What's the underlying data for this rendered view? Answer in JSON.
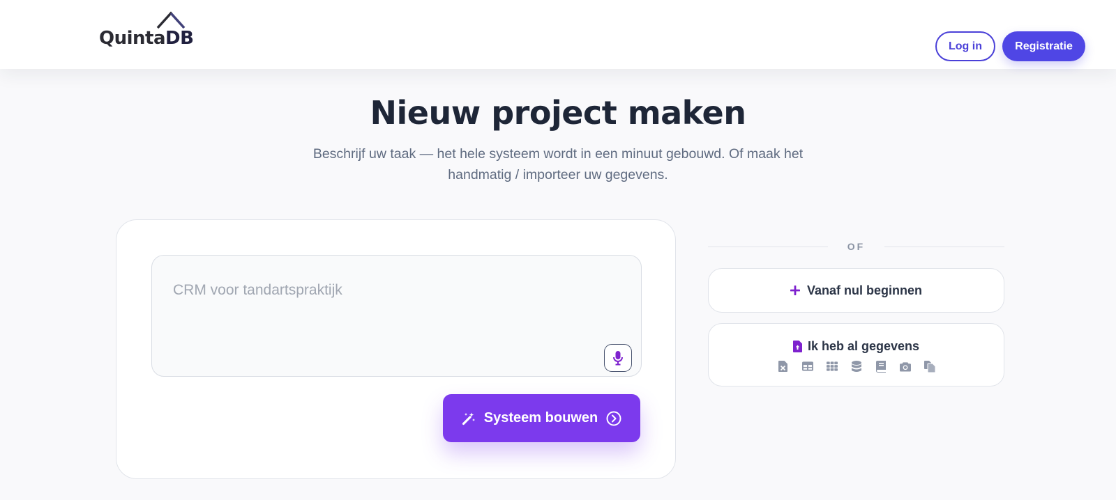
{
  "header": {
    "logo": {
      "text_main": "Quinta",
      "text_accent": "DB"
    },
    "login_label": "Log in",
    "register_label": "Registratie"
  },
  "main": {
    "title": "Nieuw project maken",
    "subtitle": "Beschrijf uw taak — het hele systeem wordt in een minuut gebouwd. Of maak het handmatig / importeer uw gegevens.",
    "prompt": {
      "value": "",
      "placeholder": "CRM voor tandartspraktijk",
      "mic_icon": "microphone-icon"
    },
    "build_button": {
      "label": "Systeem bouwen",
      "icon_left": "magic-wand-icon",
      "icon_right": "chevron-right-circle-icon"
    }
  },
  "side": {
    "divider_label": "OF",
    "scratch": {
      "label": "Vanaf nul beginnen",
      "icon": "plus-icon"
    },
    "import": {
      "label": "Ik heb al gegevens",
      "icon": "file-upload-icon",
      "format_icons": [
        "excel-file-icon",
        "table-icon",
        "grid-icon",
        "database-icon",
        "book-icon",
        "camera-icon",
        "copy-files-icon"
      ]
    }
  },
  "colors": {
    "primary": "#4f46e5",
    "build": "#7c3aed",
    "accent_icon": "#7e22ce",
    "heading": "#1e2637",
    "muted": "#5f6b80"
  }
}
